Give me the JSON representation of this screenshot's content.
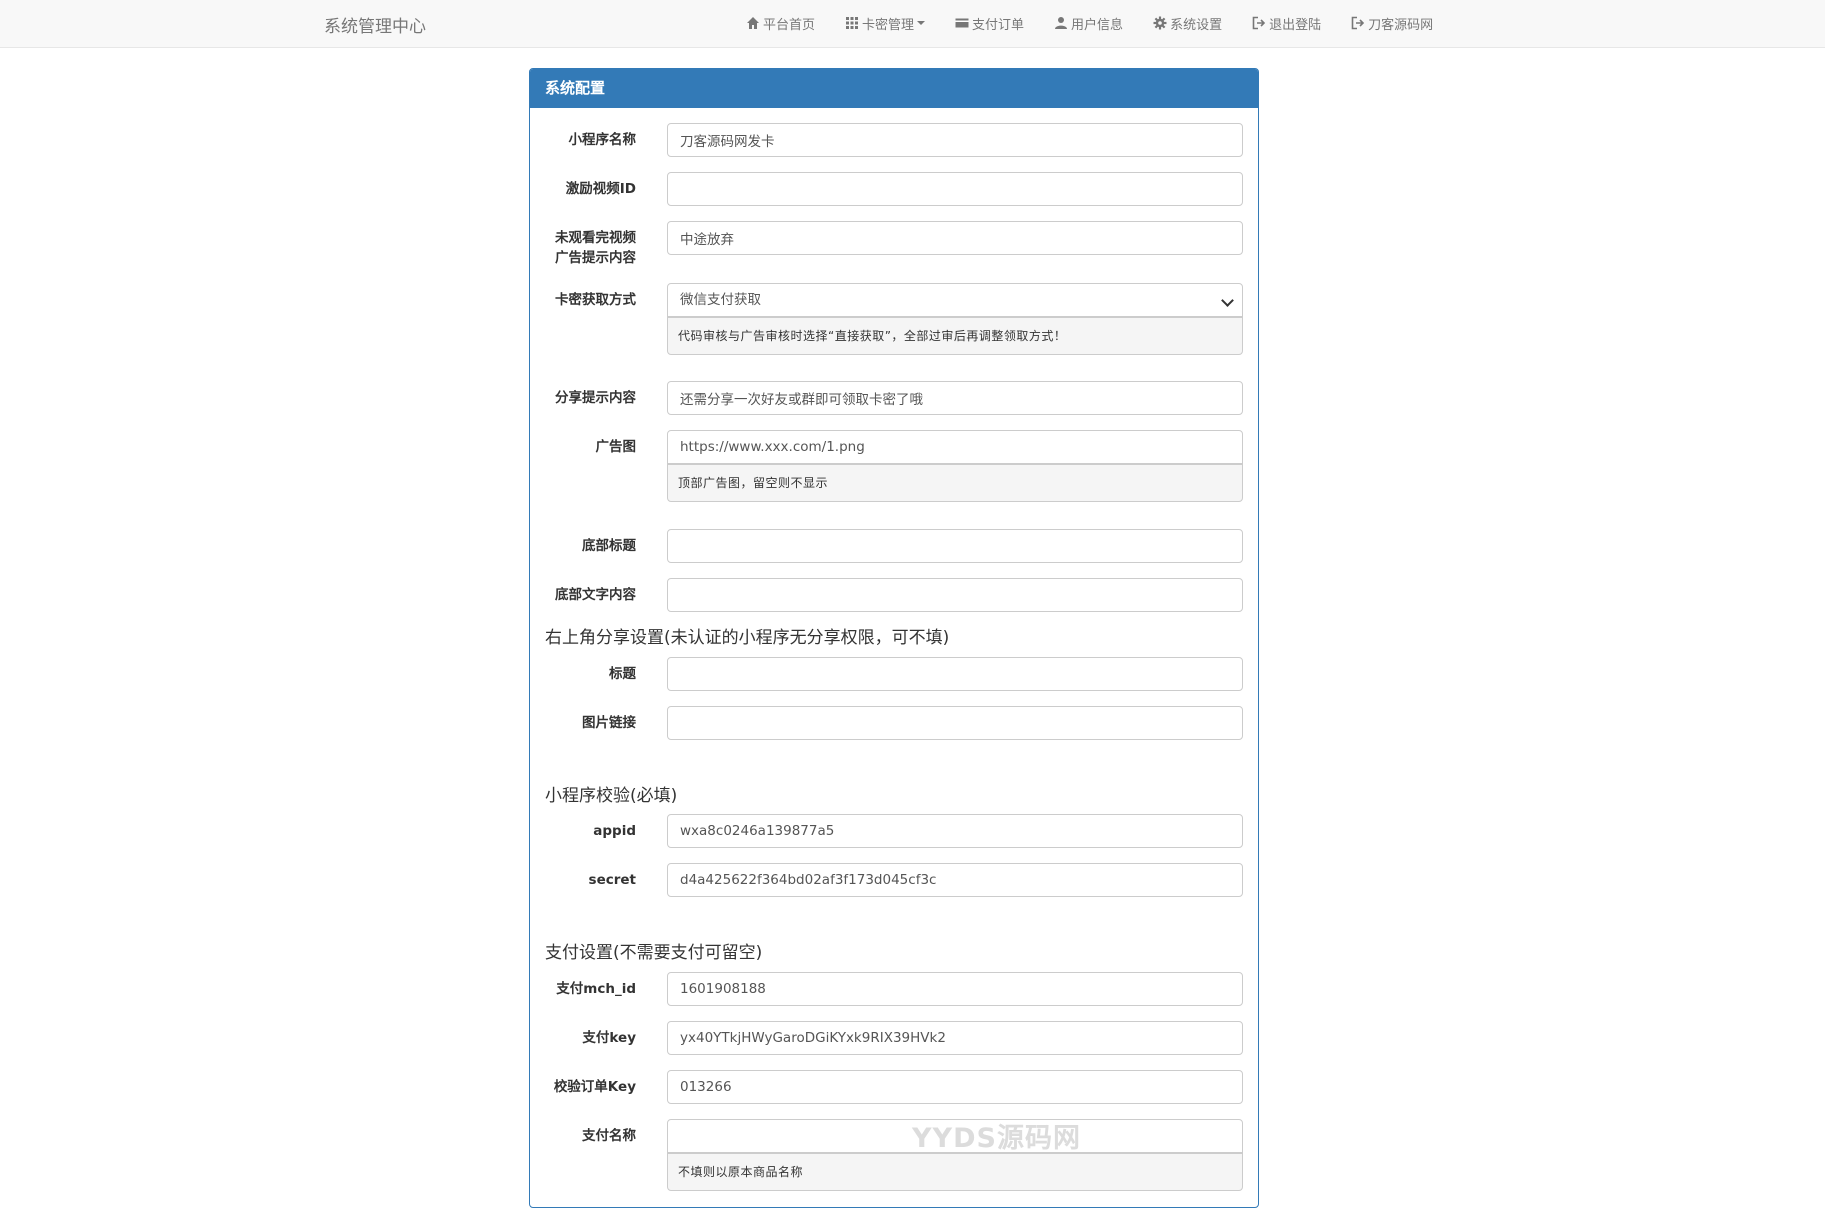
{
  "navbar": {
    "brand": "系统管理中心",
    "items": [
      {
        "label": "平台首页",
        "icon": "home-icon"
      },
      {
        "label": "卡密管理",
        "icon": "grid-icon",
        "dropdown": true
      },
      {
        "label": "支付订单",
        "icon": "credit-card-icon"
      },
      {
        "label": "用户信息",
        "icon": "user-icon"
      },
      {
        "label": "系统设置",
        "icon": "gear-icon"
      },
      {
        "label": "退出登陆",
        "icon": "logout-icon"
      },
      {
        "label": "刀客源码网",
        "icon": "external-link-icon"
      }
    ]
  },
  "panel": {
    "title": "系统配置",
    "accent_color": "#337ab7"
  },
  "form": {
    "app_name": {
      "label": "小程序名称",
      "value": "刀客源码网发卡"
    },
    "reward_video_id": {
      "label": "激励视频ID",
      "value": ""
    },
    "unfinished_video_tip": {
      "label_line1": "未观看完视频",
      "label_line2": "广告提示内容",
      "value": "中途放弃"
    },
    "card_fetch_method": {
      "label": "卡密获取方式",
      "selected": "微信支付获取",
      "help": "代码审核与广告审核时选择“直接获取”，全部过审后再调整领取方式！"
    },
    "share_tip": {
      "label": "分享提示内容",
      "value": "还需分享一次好友或群即可领取卡密了哦"
    },
    "ad_image": {
      "label": "广告图",
      "value": "https://www.xxx.com/1.png",
      "help": "顶部广告图，留空则不显示"
    },
    "footer_title": {
      "label": "底部标题",
      "value": ""
    },
    "footer_text": {
      "label": "底部文字内容",
      "value": ""
    }
  },
  "share_section": {
    "title": "右上角分享设置(未认证的小程序无分享权限，可不填)",
    "title_field": {
      "label": "标题",
      "value": ""
    },
    "image_link": {
      "label": "图片链接",
      "value": ""
    }
  },
  "verify_section": {
    "title": "小程序校验(必填)",
    "appid": {
      "label": "appid",
      "value": "wxa8c0246a139877a5"
    },
    "secret": {
      "label": "secret",
      "value": "d4a425622f364bd02af3f173d045cf3c"
    }
  },
  "payment_section": {
    "title": "支付设置(不需要支付可留空)",
    "mch_id": {
      "label": "支付mch_id",
      "value": "1601908188"
    },
    "pay_key": {
      "label": "支付key",
      "value": "yx40YTkjHWyGaroDGiKYxk9RIX39HVk2"
    },
    "order_key": {
      "label": "校验订单Key",
      "value": "013266"
    },
    "pay_name": {
      "label": "支付名称",
      "value": "",
      "help": "不填则以原本商品名称"
    }
  },
  "watermark": "YYDS源码网"
}
